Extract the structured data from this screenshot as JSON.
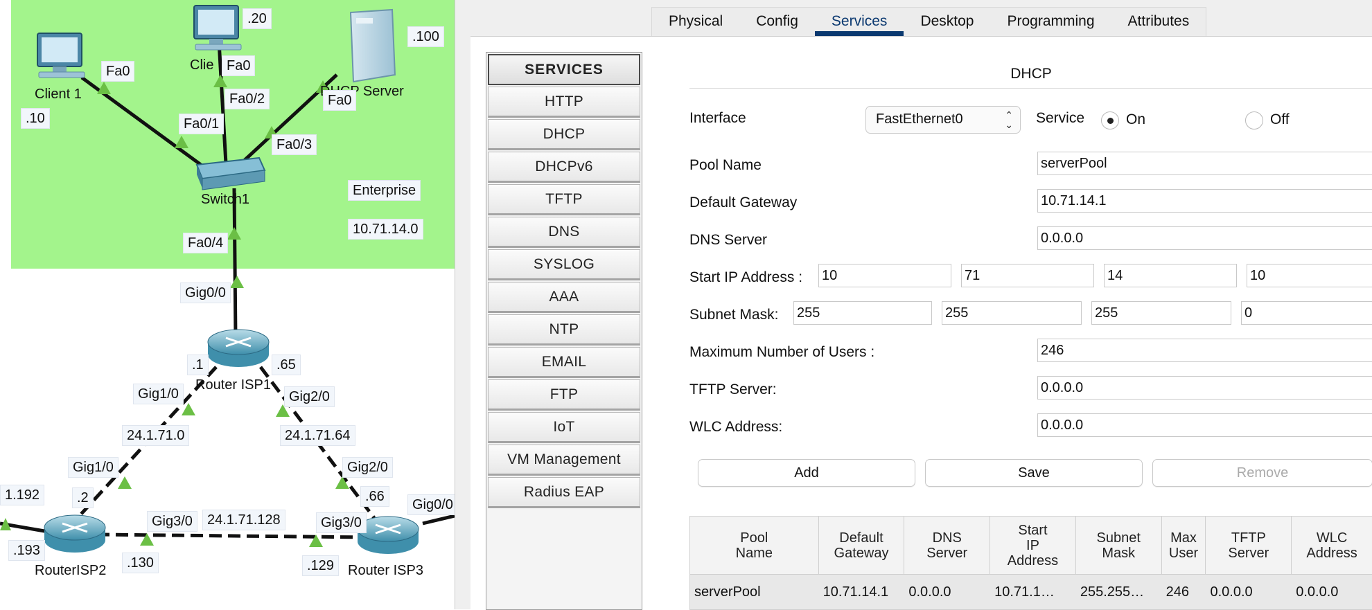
{
  "topology": {
    "enterprise_label": "Enterprise",
    "enterprise_net": "10.71.14.0",
    "devices": {
      "client1": "Client 1",
      "client2": "Clie",
      "dhcp_server": "DHCP Server",
      "switch1": "Switch1",
      "router_isp1": "Router ISP1",
      "router_isp2": "RouterISP2",
      "router_isp3": "Router ISP3"
    },
    "labels": {
      "client1_port": "Fa0",
      "client1_ip": ".10",
      "client2_ip": ".20",
      "client2_port": "Fa0",
      "server_ip": ".100",
      "server_port": "Fa0",
      "sw_fa01": "Fa0/1",
      "sw_fa02": "Fa0/2",
      "sw_fa03": "Fa0/3",
      "sw_fa04": "Fa0/4",
      "r1_gig00": "Gig0/0",
      "r1_ip1": ".1",
      "r1_ip65": ".65",
      "r1_gig10": "Gig1/0",
      "r1_gig20": "Gig2/0",
      "net_24_1_71_0": "24.1.71.0",
      "net_24_1_71_64": "24.1.71.64",
      "r2_gig10": "Gig1/0",
      "r2_ip2": ".2",
      "r3_gig20": "Gig2/0",
      "r3_ip66": ".66",
      "r3_gig00": "Gig0/0",
      "left_net": "1.192",
      "r2_ip193": ".193",
      "r2_gig30": "Gig3/0",
      "net_24_1_71_128": "24.1.71.128",
      "r3_gig30": "Gig3/0",
      "r2_ip130": ".130",
      "r3_ip129": ".129"
    }
  },
  "tabs": [
    "Physical",
    "Config",
    "Services",
    "Desktop",
    "Programming",
    "Attributes"
  ],
  "active_tab": "Services",
  "services_menu": {
    "header": "SERVICES",
    "items": [
      "HTTP",
      "DHCP",
      "DHCPv6",
      "TFTP",
      "DNS",
      "SYSLOG",
      "AAA",
      "NTP",
      "EMAIL",
      "FTP",
      "IoT",
      "VM Management",
      "Radius EAP"
    ]
  },
  "dhcp": {
    "title": "DHCP",
    "interface_label": "Interface",
    "interface_value": "FastEthernet0",
    "service_label": "Service",
    "service_on_label": "On",
    "service_off_label": "Off",
    "service_state": "On",
    "pool_name_label": "Pool Name",
    "pool_name": "serverPool",
    "default_gateway_label": "Default Gateway",
    "default_gateway": "10.71.14.1",
    "dns_server_label": "DNS Server",
    "dns_server": "0.0.0.0",
    "start_ip_label": "Start IP Address :",
    "start_ip": [
      "10",
      "71",
      "14",
      "10"
    ],
    "subnet_mask_label": "Subnet Mask:",
    "subnet_mask": [
      "255",
      "255",
      "255",
      "0"
    ],
    "max_users_label": "Maximum Number of Users :",
    "max_users": "246",
    "tftp_label": "TFTP Server:",
    "tftp_server": "0.0.0.0",
    "wlc_label": "WLC Address:",
    "wlc_address": "0.0.0.0",
    "buttons": {
      "add": "Add",
      "save": "Save",
      "remove": "Remove"
    },
    "table": {
      "headers": [
        "Pool\nName",
        "Default\nGateway",
        "DNS\nServer",
        "Start\nIP\nAddress",
        "Subnet\nMask",
        "Max\nUser",
        "TFTP\nServer",
        "WLC\nAddress"
      ],
      "rows": [
        [
          "serverPool",
          "10.71.14.1",
          "0.0.0.0",
          "10.71.1…",
          "255.255…",
          "246",
          "0.0.0.0",
          "0.0.0.0"
        ]
      ]
    }
  },
  "colors": {
    "enterprise_bg": "#a3f48c",
    "tab_accent": "#0b3970",
    "link_triangle": "#6bbf45"
  }
}
